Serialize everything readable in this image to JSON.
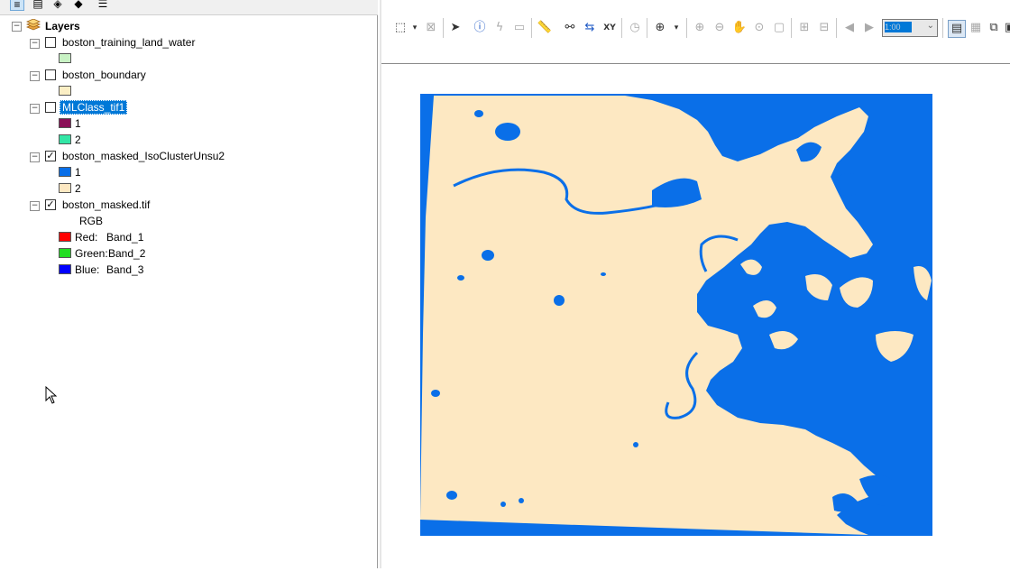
{
  "toc": {
    "root_label": "Layers",
    "layers": [
      {
        "name": "boston_training_land_water",
        "checked": false,
        "selected": false,
        "legend": [
          {
            "label": "",
            "color": "#c8f2c4"
          }
        ]
      },
      {
        "name": "boston_boundary",
        "checked": false,
        "selected": false,
        "legend": [
          {
            "label": "",
            "color": "#fbeec4"
          }
        ]
      },
      {
        "name": "MLClass_tif1",
        "checked": false,
        "selected": true,
        "legend": [
          {
            "label": "1",
            "color": "#8b0f58"
          },
          {
            "label": "2",
            "color": "#33e6a6"
          }
        ]
      },
      {
        "name": "boston_masked_IsoClusterUnsu2",
        "checked": true,
        "selected": false,
        "legend": [
          {
            "label": "1",
            "color": "#0a6fe8"
          },
          {
            "label": "2",
            "color": "#fde8c2"
          }
        ]
      },
      {
        "name": "boston_masked.tif",
        "checked": true,
        "selected": false,
        "rgb_label": "RGB",
        "bands": [
          {
            "channel": "Red:",
            "band": "Band_1",
            "color": "#ff0000"
          },
          {
            "channel": "Green:",
            "band": "Band_2",
            "color": "#22dd22"
          },
          {
            "channel": "Blue:",
            "band": "Band_3",
            "color": "#0000ff"
          }
        ]
      }
    ]
  },
  "toolbar": {
    "scale_value": "1:00"
  },
  "map": {
    "water_color": "#0a6fe8",
    "land_color": "#fde8c2"
  }
}
